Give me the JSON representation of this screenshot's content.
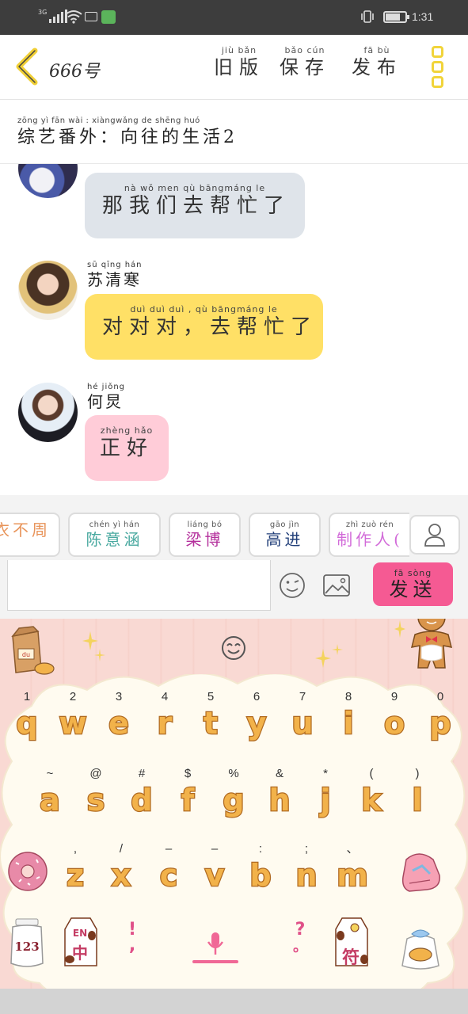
{
  "status_bar": {
    "network": "3G",
    "time": "1:31"
  },
  "header": {
    "title": "666号",
    "actions": [
      {
        "pinyin": "jiù bǎn",
        "text": "旧版"
      },
      {
        "pinyin": "bǎo cún",
        "text": "保存"
      },
      {
        "pinyin": "fā bù",
        "text": "发布"
      }
    ]
  },
  "subtitle": {
    "pinyin": "zōng yì fān wài : xiàngwǎng de shēng huó",
    "text": "综艺番外：向往的生活2"
  },
  "messages": [
    {
      "sender": null,
      "pinyin": "nà wǒ men qù bāngmáng le",
      "text": "那我们去帮忙了",
      "bubble_color": "#dfe4ea"
    },
    {
      "sender": {
        "pinyin": "sū qīng hán",
        "text": "苏清寒"
      },
      "pinyin": "duì duì duì , qù bāngmáng le",
      "text": "对对对，去帮忙了",
      "bubble_color": "#ffe066"
    },
    {
      "sender": {
        "pinyin": "hé jiǒng",
        "text": "何炅"
      },
      "pinyin": "zhèng hǎo",
      "text": "正好",
      "bubble_color": "#ffccd8"
    }
  ],
  "quick_chips": [
    {
      "pinyin": "",
      "text": "衣不周",
      "color": "#e8945a"
    },
    {
      "pinyin": "chén yì hán",
      "text": "陈意涵",
      "color": "#49a9a0"
    },
    {
      "pinyin": "liáng bó",
      "text": "梁博",
      "color": "#b4309c"
    },
    {
      "pinyin": "gāo jìn",
      "text": "高进",
      "color": "#23407a"
    },
    {
      "pinyin": "zhì zuò rén",
      "text": "制作人(",
      "color": "#d26bd9"
    }
  ],
  "composer": {
    "input_value": "",
    "send_button": {
      "pinyin": "fā sòng",
      "text": "发送"
    }
  },
  "keyboard": {
    "row1": [
      {
        "sym": "1",
        "letter": "q"
      },
      {
        "sym": "2",
        "letter": "w"
      },
      {
        "sym": "3",
        "letter": "e"
      },
      {
        "sym": "4",
        "letter": "r"
      },
      {
        "sym": "5",
        "letter": "t"
      },
      {
        "sym": "6",
        "letter": "y"
      },
      {
        "sym": "7",
        "letter": "u"
      },
      {
        "sym": "8",
        "letter": "i"
      },
      {
        "sym": "9",
        "letter": "o"
      },
      {
        "sym": "0",
        "letter": "p"
      }
    ],
    "row2": [
      {
        "sym": "~",
        "letter": "a"
      },
      {
        "sym": "@",
        "letter": "s"
      },
      {
        "sym": "#",
        "letter": "d"
      },
      {
        "sym": "$",
        "letter": "f"
      },
      {
        "sym": "%",
        "letter": "g"
      },
      {
        "sym": "&",
        "letter": "h"
      },
      {
        "sym": "*",
        "letter": "j"
      },
      {
        "sym": "(",
        "letter": "k"
      },
      {
        "sym": ")",
        "letter": "l"
      }
    ],
    "row3": [
      {
        "sym": ",",
        "letter": "z"
      },
      {
        "sym": "/",
        "letter": "x"
      },
      {
        "sym": "–",
        "letter": "c"
      },
      {
        "sym": "–",
        "letter": "v"
      },
      {
        "sym": ":",
        "letter": "b"
      },
      {
        "sym": ";",
        "letter": "n"
      },
      {
        "sym": "、",
        "letter": "m"
      }
    ],
    "bottom": {
      "num_key": "123",
      "lang_key_top": "EN",
      "lang_key": "中",
      "comma_sym": "!",
      "comma": ",",
      "period_sym": "?",
      "period": "。",
      "symbols_key": "符"
    },
    "deco_logo": "du"
  }
}
